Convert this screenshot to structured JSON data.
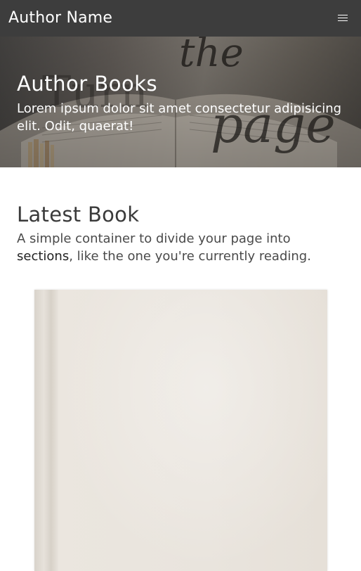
{
  "navbar": {
    "brand": "Author Name",
    "menu_icon": "hamburger-menu-icon"
  },
  "hero": {
    "title": "Author Books",
    "text": "Lorem ipsum dolor sit amet consectetur adipisicing elit. Odit, quaerat!",
    "background_image_text": "Turn the page"
  },
  "section": {
    "title": "Latest Book",
    "text_before": "A simple container to divide your page into ",
    "text_strong": "sections",
    "text_after": ", like the one you're currently reading."
  },
  "colors": {
    "navbar": "#3d3d3d",
    "text": "#3a3a3a",
    "book_cover": "#e9e4dd"
  }
}
